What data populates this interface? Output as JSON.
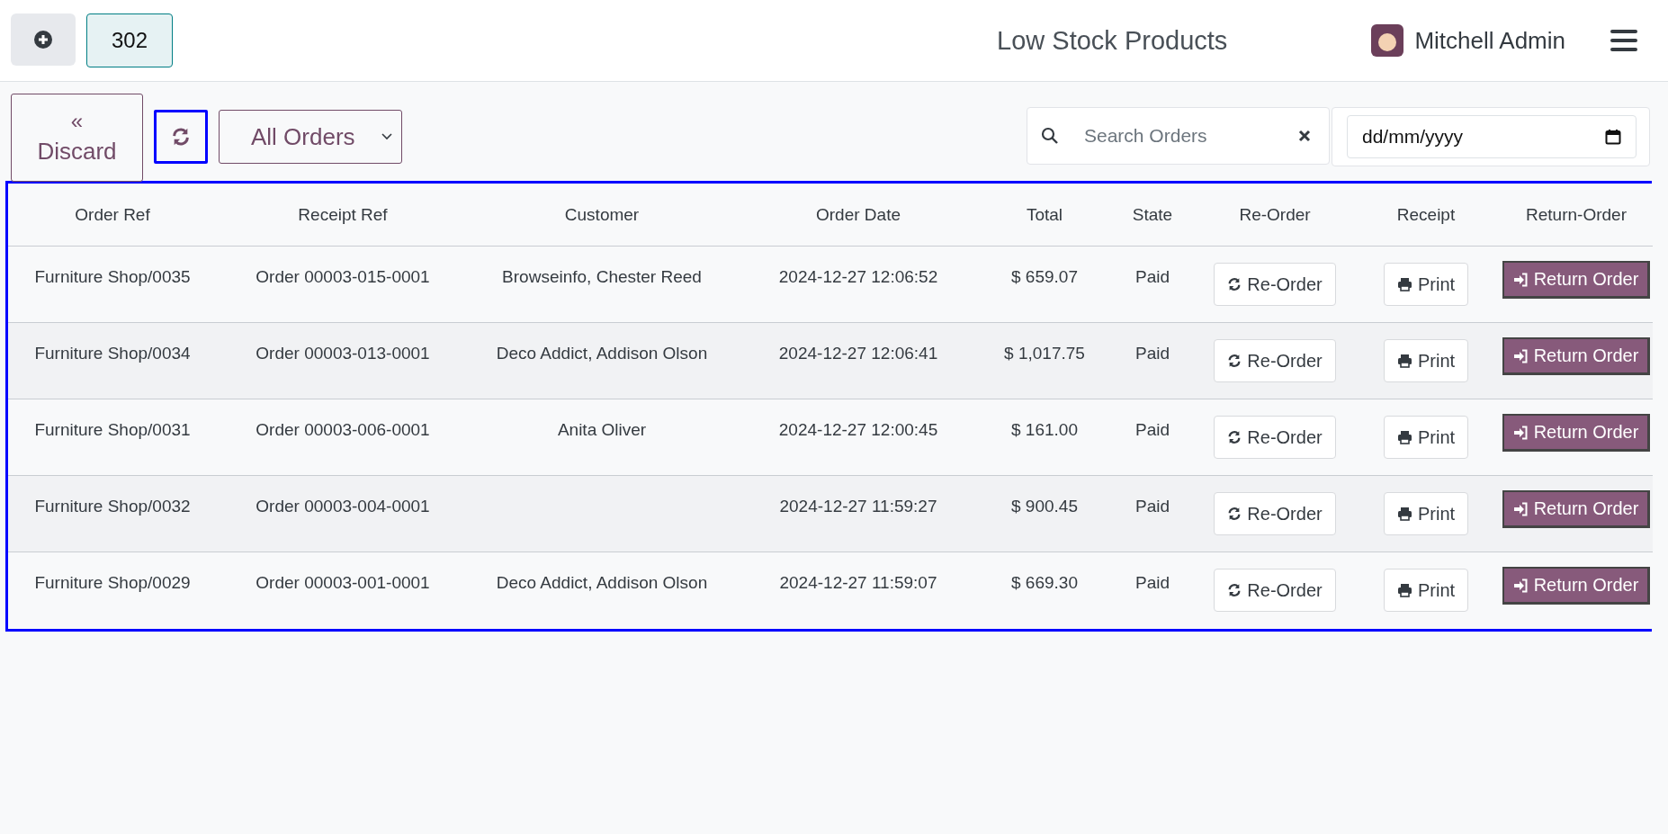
{
  "header": {
    "order_count": "302",
    "title": "Low Stock Products",
    "user": "Mitchell Admin"
  },
  "toolbar": {
    "discard": {
      "icon": "«",
      "label": "Discard"
    },
    "filter": "All Orders",
    "search": {
      "placeholder": "Search Orders"
    },
    "date": {
      "placeholder": "dd/mm/yyyy"
    }
  },
  "table": {
    "columns": [
      "Order Ref",
      "Receipt Ref",
      "Customer",
      "Order Date",
      "Total",
      "State",
      "Re-Order",
      "Receipt",
      "Return-Order"
    ],
    "rows": [
      {
        "order_ref": "Furniture Shop/0035",
        "receipt_ref": "Order 00003-015-0001",
        "customer": "Browseinfo, Chester Reed",
        "order_date": "2024-12-27 12:06:52",
        "total": "$ 659.07",
        "state": "Paid",
        "reorder": "Re-Order",
        "print": "Print",
        "return": "Return Order"
      },
      {
        "order_ref": "Furniture Shop/0034",
        "receipt_ref": "Order 00003-013-0001",
        "customer": "Deco Addict, Addison Olson",
        "order_date": "2024-12-27 12:06:41",
        "total": "$ 1,017.75",
        "state": "Paid",
        "reorder": "Re-Order",
        "print": "Print",
        "return": "Return Order"
      },
      {
        "order_ref": "Furniture Shop/0031",
        "receipt_ref": "Order 00003-006-0001",
        "customer": "Anita Oliver",
        "order_date": "2024-12-27 12:00:45",
        "total": "$ 161.00",
        "state": "Paid",
        "reorder": "Re-Order",
        "print": "Print",
        "return": "Return Order"
      },
      {
        "order_ref": "Furniture Shop/0032",
        "receipt_ref": "Order 00003-004-0001",
        "order_date": "2024-12-27 11:59:27",
        "total": "$ 900.45",
        "state": "Paid",
        "reorder": "Re-Order",
        "print": "Print",
        "return": "Return Order"
      },
      {
        "order_ref": "Furniture Shop/0029",
        "receipt_ref": "Order 00003-001-0001",
        "customer": "Deco Addict, Addison Olson",
        "order_date": "2024-12-27 11:59:07",
        "total": "$ 669.30",
        "state": "Paid",
        "reorder": "Re-Order",
        "print": "Print",
        "return": "Return Order"
      }
    ]
  }
}
